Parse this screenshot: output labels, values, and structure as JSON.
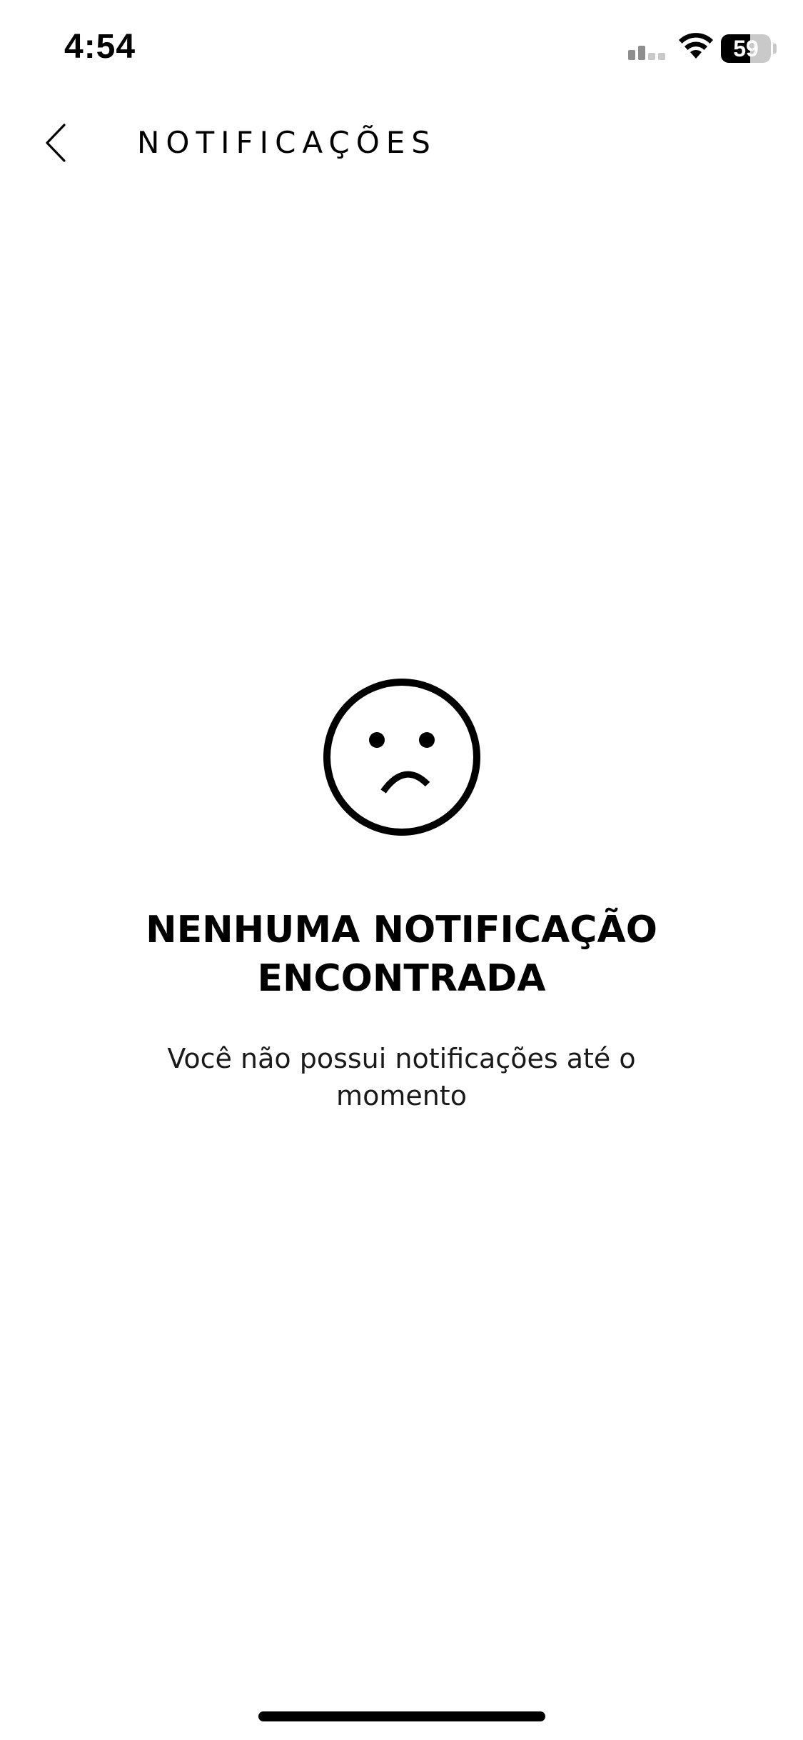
{
  "status_bar": {
    "time": "4:54",
    "battery_text": "59",
    "battery_level": 0.59
  },
  "header": {
    "title": "NOTIFICAÇÕES"
  },
  "empty_state": {
    "icon": "sad-face-icon",
    "title": "NENHUMA NOTIFICAÇÃO ENCONTRADA",
    "message": "Você não possui notificações até o momento"
  },
  "icons": {
    "back": "chevron-left-icon",
    "signal": "cellular-signal-icon",
    "wifi": "wifi-icon",
    "battery": "battery-icon"
  },
  "colors": {
    "background": "#ffffff",
    "foreground": "#000000",
    "battery_empty": "#c9c9c9"
  }
}
